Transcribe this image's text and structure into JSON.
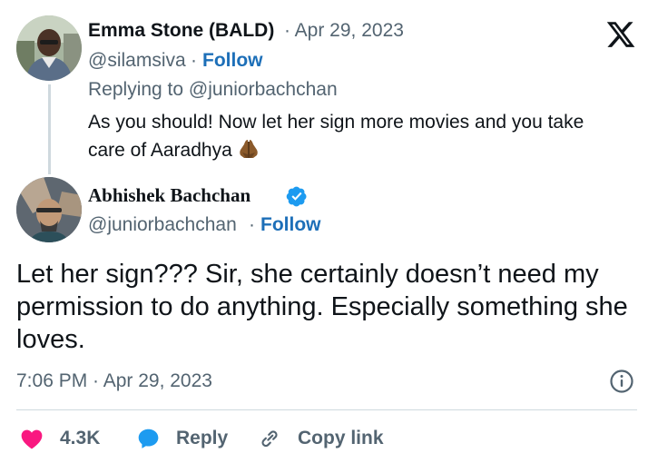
{
  "reply_tweet": {
    "author_name": "Emma Stone (BALD)",
    "date": "· Apr 29, 2023",
    "handle": "@silamsiva",
    "separator": "·",
    "follow_label": "Follow",
    "replying_to": "Replying to @juniorbachchan",
    "body_line1": "As you should! Now let her sign more movies and you take",
    "body_line2": "care of Aaradhya",
    "emoji": "folded-hands-emoji"
  },
  "main_tweet": {
    "author_name": "Abhishek Bachchan",
    "verified": true,
    "handle": "@juniorbachchan",
    "separator": "·",
    "follow_label": "Follow",
    "body": "Let her sign??? Sir, she certainly doesn’t need my permission to do anything. Especially something she loves.",
    "timestamp": "7:06 PM · Apr 29, 2023"
  },
  "actions": {
    "like_count": "4.3K",
    "reply_label": "Reply",
    "copy_label": "Copy link"
  },
  "colors": {
    "like": "#f91880",
    "reply": "#1d9bf0",
    "link": "#1d6fb8",
    "muted": "#536471",
    "verified": "#1d9bf0"
  },
  "icons": [
    "x-logo",
    "verified-badge-icon",
    "info-icon",
    "heart-icon",
    "reply-bubble-icon",
    "link-icon"
  ]
}
